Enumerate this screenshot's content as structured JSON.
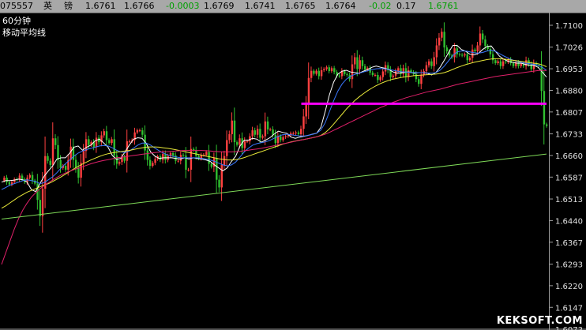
{
  "top_bar": {
    "code": "075557",
    "name1": "英",
    "name2": "镑",
    "open": "1.6761",
    "high": "1.6766",
    "change": "-0.0003",
    "v1": "1.6769",
    "v2": "1.6741",
    "v3": "1.6765",
    "v4": "1.6764",
    "pct": "-0.02",
    "v5": "0.17",
    "last": "1.6761",
    "colors": {
      "text": "#000000",
      "green": "#00a000",
      "bg": "#a8a8a8"
    }
  },
  "labels": {
    "period": "60分钟",
    "indicator": "移动平均线"
  },
  "watermark": "KEKSOFT.COM",
  "chart_data": {
    "type": "line",
    "y_ticks": [
      "1.7100",
      "1.7026",
      "1.6953",
      "1.6880",
      "1.6807",
      "1.6733",
      "1.6660",
      "1.6587",
      "1.6513",
      "1.6440",
      "1.6367",
      "1.6293",
      "1.6220",
      "1.6147",
      "1.6073"
    ],
    "ylim": [
      1.6073,
      1.7132
    ],
    "price": [
      1.6575,
      1.6585,
      1.657,
      1.6562,
      1.657,
      1.658,
      1.6578,
      1.6592,
      1.658,
      1.657,
      1.6585,
      1.6594,
      1.6575,
      1.6565,
      1.651,
      1.6455,
      1.6548,
      1.6658,
      1.6642,
      1.6628,
      1.6718,
      1.6695,
      1.6645,
      1.6618,
      1.6625,
      1.6612,
      1.6645,
      1.669,
      1.6645,
      1.6618,
      1.6585,
      1.6635,
      1.6675,
      1.6715,
      1.6695,
      1.6705,
      1.6688,
      1.672,
      1.6705,
      1.6728,
      1.6742,
      1.6712,
      1.6702,
      1.6715,
      1.666,
      1.6632,
      1.6638,
      1.6655,
      1.6642,
      1.6708,
      1.6708,
      1.6712,
      1.6738,
      1.6745,
      1.6745,
      1.673,
      1.6677,
      1.6645,
      1.6625,
      1.6635,
      1.6648,
      1.6657,
      1.6645,
      1.6665,
      1.6645,
      1.6658,
      1.6668,
      1.666,
      1.6642,
      1.6642,
      1.6662,
      1.666,
      1.6612,
      1.6612,
      1.6682,
      1.6678,
      1.6658,
      1.665,
      1.6662,
      1.6662,
      1.6672,
      1.6632,
      1.6622,
      1.6652,
      1.6578,
      1.6552,
      1.6628,
      1.6658,
      1.6712,
      1.6732,
      1.6778,
      1.6705,
      1.6696,
      1.6718,
      1.6685,
      1.6708,
      1.6708,
      1.6725,
      1.6745,
      1.673,
      1.675,
      1.672,
      1.6725,
      1.6775,
      1.6748,
      1.6748,
      1.673,
      1.6702,
      1.6725,
      1.6712,
      1.6722,
      1.6725,
      1.6728,
      1.6735,
      1.6735,
      1.6738,
      1.6732,
      1.675,
      1.6792,
      1.6835,
      1.6922,
      1.6946,
      1.6936,
      1.6946,
      1.6928,
      1.6948,
      1.6952,
      1.6958,
      1.6945,
      1.6955,
      1.6942,
      1.693,
      1.6928,
      1.6945,
      1.6935,
      1.6932,
      1.6918,
      1.6968,
      1.6992,
      1.6952,
      1.6982,
      1.6962,
      1.695,
      1.6955,
      1.694,
      1.6932,
      1.6932,
      1.6915,
      1.6925,
      1.6944,
      1.6965,
      1.6948,
      1.6925,
      1.693,
      1.6945,
      1.6955,
      1.6935,
      1.6955,
      1.6925,
      1.6948,
      1.6942,
      1.6935,
      1.6918,
      1.6902,
      1.6932,
      1.6945,
      1.6965,
      1.6978,
      1.6962,
      1.6992,
      1.7032,
      1.7058,
      1.7078,
      1.7025,
      1.7012,
      1.6998,
      1.6992,
      1.7022,
      1.7002,
      1.7,
      1.6998,
      1.7002,
      1.6982,
      1.699,
      1.7018,
      1.7012,
      1.7032,
      1.7072,
      1.7052,
      1.703,
      1.702,
      1.7002,
      1.6982,
      1.6972,
      1.6978,
      1.6962,
      1.6978,
      1.6975,
      1.6985,
      1.6972,
      1.6962,
      1.6975,
      1.6962,
      1.697,
      1.6962,
      1.6982,
      1.6968,
      1.6952,
      1.6972,
      1.6965,
      1.6962,
      1.6878,
      1.6765,
      1.676
    ],
    "series": [
      {
        "values": [
          1.657,
          1.6575,
          1.6575,
          1.6577,
          1.658,
          1.6578,
          1.657,
          1.6545,
          1.6538,
          1.6565,
          1.659,
          1.6608,
          1.6625,
          1.6648,
          1.6652,
          1.6652,
          1.6668,
          1.6688,
          1.6692,
          1.6678,
          1.6688,
          1.6695,
          1.671,
          1.6715,
          1.6702,
          1.6688,
          1.666,
          1.6647,
          1.665,
          1.6672,
          1.6695,
          1.6715,
          1.672,
          1.6718,
          1.67,
          1.6672,
          1.6658,
          1.665,
          1.6652,
          1.6652,
          1.6652,
          1.665,
          1.6648,
          1.6652,
          1.6648,
          1.6652,
          1.665,
          1.6648,
          1.6645,
          1.664,
          1.6628,
          1.6618,
          1.6608,
          1.6618,
          1.664,
          1.6658,
          1.6692,
          1.6712,
          1.6712,
          1.6718,
          1.6715,
          1.6705,
          1.6712,
          1.672,
          1.6732,
          1.6742,
          1.6738,
          1.6735,
          1.6722,
          1.6718,
          1.6722,
          1.6725,
          1.6728,
          1.6732,
          1.6735,
          1.6755,
          1.6808,
          1.6865,
          1.6908,
          1.6935,
          1.6945,
          1.6948,
          1.6942,
          1.694,
          1.6938,
          1.6945,
          1.695,
          1.6958,
          1.6962,
          1.6958,
          1.6955,
          1.695,
          1.6942,
          1.6938,
          1.694,
          1.6942,
          1.6942,
          1.6938,
          1.694,
          1.694,
          1.6938,
          1.6932,
          1.694,
          1.6958,
          1.6982,
          1.7008,
          1.7032,
          1.7032,
          1.7018,
          1.7012,
          1.7002,
          1.7,
          1.7005,
          1.7018,
          1.7028,
          1.703,
          1.7012,
          1.6995,
          1.6985,
          1.6978,
          1.6975,
          1.6972,
          1.6972,
          1.6968,
          1.6965,
          1.6965,
          1.6958,
          1.6942,
          1.6925
        ]
      },
      {
        "values": [
          1.6545,
          1.6552,
          1.656,
          1.6565,
          1.657,
          1.6575,
          1.6578,
          1.6575,
          1.6572,
          1.6565,
          1.6568,
          1.6578,
          1.6588,
          1.6602,
          1.6618,
          1.6632,
          1.6645,
          1.6658,
          1.6668,
          1.6675,
          1.668,
          1.6684,
          1.6688,
          1.6692,
          1.6694,
          1.6692,
          1.6686,
          1.6678,
          1.6672,
          1.667,
          1.6675,
          1.6685,
          1.6695,
          1.6702,
          1.6702,
          1.6695,
          1.6685,
          1.6676,
          1.6668,
          1.6662,
          1.6658,
          1.6655,
          1.6652,
          1.6652,
          1.6652,
          1.6652,
          1.6652,
          1.665,
          1.6648,
          1.6645,
          1.664,
          1.6634,
          1.6628,
          1.6625,
          1.6628,
          1.6638,
          1.6655,
          1.6672,
          1.6685,
          1.6695,
          1.67,
          1.6703,
          1.6706,
          1.6711,
          1.6718,
          1.6725,
          1.673,
          1.6732,
          1.673,
          1.6728,
          1.6726,
          1.6726,
          1.6728,
          1.6731,
          1.6735,
          1.6746,
          1.677,
          1.6808,
          1.6845,
          1.6878,
          1.6902,
          1.6918,
          1.6928,
          1.6934,
          1.6938,
          1.6942,
          1.6946,
          1.695,
          1.6953,
          1.6954,
          1.6953,
          1.6951,
          1.6948,
          1.6945,
          1.6943,
          1.6942,
          1.6941,
          1.694,
          1.694,
          1.694,
          1.6939,
          1.6938,
          1.694,
          1.6948,
          1.6962,
          1.698,
          1.6998,
          1.701,
          1.7013,
          1.7013,
          1.701,
          1.7007,
          1.7006,
          1.7008,
          1.7013,
          1.7016,
          1.7012,
          1.7004,
          1.6996,
          1.6989,
          1.6983,
          1.6978,
          1.6975,
          1.6972,
          1.697,
          1.6968,
          1.6965,
          1.6958,
          1.6948
        ]
      },
      {
        "values": [
          1.6482,
          1.649,
          1.65,
          1.651,
          1.652,
          1.6528,
          1.6536,
          1.6542,
          1.6548,
          1.6554,
          1.656,
          1.6565,
          1.6572,
          1.658,
          1.6588,
          1.6597,
          1.6606,
          1.6615,
          1.6623,
          1.6631,
          1.6638,
          1.6645,
          1.6651,
          1.6657,
          1.6662,
          1.6666,
          1.6669,
          1.6671,
          1.6673,
          1.6675,
          1.6677,
          1.668,
          1.6683,
          1.6686,
          1.6688,
          1.6689,
          1.6689,
          1.6688,
          1.6686,
          1.6684,
          1.6682,
          1.6679,
          1.6676,
          1.6673,
          1.667,
          1.6667,
          1.6664,
          1.6661,
          1.6658,
          1.6655,
          1.6652,
          1.6649,
          1.6647,
          1.6645,
          1.6645,
          1.6646,
          1.6649,
          1.6653,
          1.6658,
          1.6663,
          1.6668,
          1.6673,
          1.6678,
          1.6683,
          1.6688,
          1.6693,
          1.6698,
          1.6702,
          1.6706,
          1.6709,
          1.6712,
          1.6714,
          1.6717,
          1.672,
          1.6723,
          1.6728,
          1.6737,
          1.675,
          1.6766,
          1.6783,
          1.68,
          1.6817,
          1.6832,
          1.6846,
          1.6858,
          1.6869,
          1.6879,
          1.6888,
          1.6896,
          1.6903,
          1.6909,
          1.6914,
          1.6918,
          1.6921,
          1.6924,
          1.6926,
          1.6928,
          1.693,
          1.6931,
          1.6932,
          1.6933,
          1.6934,
          1.6935,
          1.6937,
          1.694,
          1.6945,
          1.6951,
          1.6957,
          1.6962,
          1.6967,
          1.6971,
          1.6975,
          1.6978,
          1.6981,
          1.6984,
          1.6986,
          1.6987,
          1.6987,
          1.6986,
          1.6984,
          1.6982,
          1.698,
          1.6978,
          1.6976,
          1.6974,
          1.6972,
          1.697,
          1.6966,
          1.696
        ]
      },
      {
        "values": [
          1.6292,
          1.6332,
          1.6372,
          1.6412,
          1.6447,
          1.6476,
          1.6499,
          1.6519,
          1.6534,
          1.6547,
          1.6558,
          1.6568,
          1.6577,
          1.6586,
          1.6594,
          1.6601,
          1.6607,
          1.6612,
          1.6617,
          1.6622,
          1.6627,
          1.6632,
          1.6636,
          1.664,
          1.6643,
          1.6646,
          1.6649,
          1.6652,
          1.6654,
          1.6656,
          1.6658,
          1.666,
          1.6662,
          1.6664,
          1.6666,
          1.6668,
          1.667,
          1.6671,
          1.6672,
          1.6673,
          1.6674,
          1.6675,
          1.6676,
          1.6677,
          1.6677,
          1.6677,
          1.6677,
          1.6677,
          1.6676,
          1.6675,
          1.6674,
          1.6673,
          1.6672,
          1.6672,
          1.6672,
          1.6673,
          1.6674,
          1.6676,
          1.6678,
          1.668,
          1.6682,
          1.6684,
          1.6687,
          1.669,
          1.6693,
          1.6696,
          1.6699,
          1.6702,
          1.6705,
          1.6708,
          1.6711,
          1.6714,
          1.6717,
          1.672,
          1.6723,
          1.6727,
          1.6732,
          1.6738,
          1.6745,
          1.6752,
          1.6759,
          1.6766,
          1.6773,
          1.678,
          1.6787,
          1.6794,
          1.6801,
          1.6808,
          1.6815,
          1.6822,
          1.6828,
          1.6834,
          1.684,
          1.6845,
          1.685,
          1.6855,
          1.6859,
          1.6863,
          1.6867,
          1.6871,
          1.6875,
          1.6878,
          1.6881,
          1.6884,
          1.6888,
          1.6892,
          1.6896,
          1.69,
          1.6903,
          1.6906,
          1.6909,
          1.6912,
          1.6915,
          1.6918,
          1.6921,
          1.6924,
          1.6927,
          1.6929,
          1.6931,
          1.6933,
          1.6935,
          1.6937,
          1.6939,
          1.6941,
          1.6943,
          1.6945,
          1.6947,
          1.6948,
          1.6947
        ]
      }
    ],
    "lines": [
      {
        "type": "trend",
        "color": "#7ed957",
        "from": [
          0,
          1.6445
        ],
        "to": [
          1,
          1.6665
        ]
      },
      {
        "type": "horizontal",
        "color": "#ff00ff",
        "value": 1.6835,
        "start": 0.55
      }
    ],
    "colors": {
      "up": "#ff4040",
      "down": "#30c030",
      "ma1": "#ffffff",
      "ma2": "#3a78ff",
      "ma3": "#e8e83a",
      "ma4": "#e0206a"
    }
  }
}
